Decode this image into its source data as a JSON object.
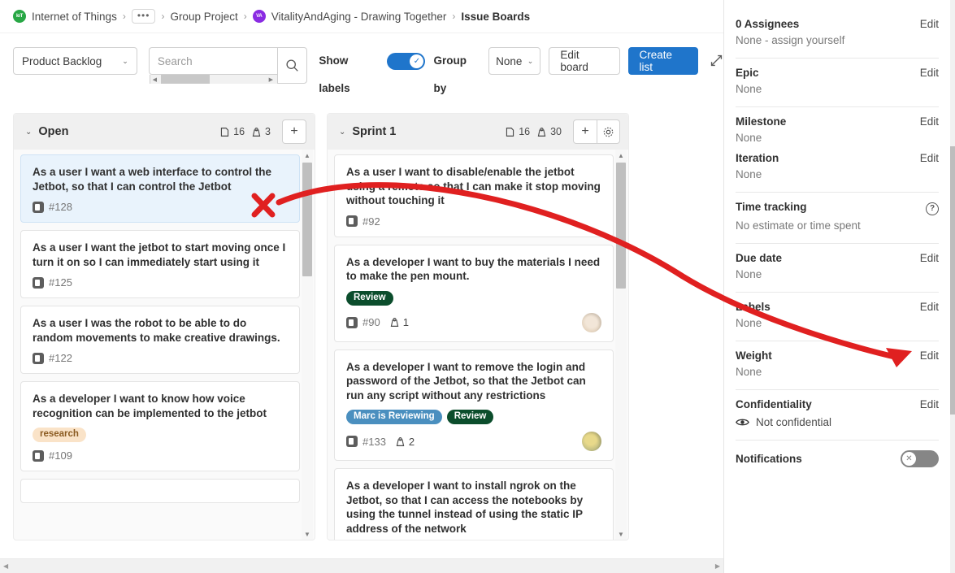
{
  "breadcrumb": {
    "items": [
      {
        "label": "Internet of Things",
        "icon": "group-avatar-green",
        "avatar_text": "IoT"
      },
      {
        "label": "•••",
        "icon": "ellipsis-button"
      },
      {
        "label": "Group Project",
        "icon": "none"
      },
      {
        "label": "VitalityAndAging - Drawing Together",
        "icon": "project-avatar-purple",
        "avatar_text": "VA"
      },
      {
        "label": "Issue Boards",
        "icon": "none",
        "current": true
      }
    ],
    "separator": "›"
  },
  "toolbar": {
    "board_select": {
      "value": "Product Backlog",
      "caret": "⌄"
    },
    "search": {
      "placeholder": "Search",
      "value": "",
      "icon": "search-icon"
    },
    "show_labels_label": "Show labels",
    "show_labels_on": true,
    "group_by_label": "Group by",
    "group_by_select": {
      "value": "None",
      "caret": "⌄"
    },
    "edit_board_label": "Edit board",
    "create_list_label": "Create list",
    "expand_icon": "expand-arrows-icon",
    "accent_color": "#1f75cb"
  },
  "board": {
    "columns": [
      {
        "title": "Open",
        "issue_count": "16",
        "weight": "3",
        "caret": "⌄",
        "actions": [
          "add-issue"
        ],
        "cards": [
          {
            "title": "As a user I want a web interface to control the Jetbot, so that I can control the Jetbot",
            "id": "#128",
            "labels": [],
            "weight": "",
            "avatar": "",
            "selected": true
          },
          {
            "title": "As a user I want the jetbot to start moving once I turn it on so I can immediately start using it",
            "id": "#125",
            "labels": [],
            "weight": "",
            "avatar": "",
            "selected": false
          },
          {
            "title": "As a user I was the robot to be able to do random movements to make creative drawings.",
            "id": "#122",
            "labels": [],
            "weight": "",
            "avatar": "",
            "selected": false
          },
          {
            "title": "As a developer I want to know how voice recognition can be implemented to the jetbot",
            "id": "#109",
            "labels": [
              {
                "text": "research",
                "bg": "#fae3c8",
                "fg": "#8a5a20"
              }
            ],
            "weight": "",
            "avatar": "",
            "selected": false
          }
        ]
      },
      {
        "title": "Sprint 1",
        "issue_count": "16",
        "weight": "30",
        "caret": "⌄",
        "actions": [
          "add-issue",
          "list-settings"
        ],
        "cards": [
          {
            "title": "As a user I want to disable/enable the jetbot using a remote so that I can make it stop moving without touching it",
            "id": "#92",
            "labels": [],
            "weight": "",
            "avatar": "",
            "selected": false
          },
          {
            "title": "As a developer I want to buy the materials I need to make the pen mount.",
            "id": "#90",
            "labels": [
              {
                "text": "Review",
                "bg": "#0b4d2c",
                "fg": "#ffffff"
              }
            ],
            "weight": "1",
            "avatar": "#e8d9c8",
            "selected": false
          },
          {
            "title": "As a developer I want to remove the login and password of the Jetbot, so that the Jetbot can run any script without any restrictions",
            "id": "#133",
            "labels": [
              {
                "text": "Marc is Reviewing",
                "bg": "#4a8fbf",
                "fg": "#ffffff"
              },
              {
                "text": "Review",
                "bg": "#0b4d2c",
                "fg": "#ffffff"
              }
            ],
            "weight": "2",
            "avatar": "#c8b87a",
            "selected": false
          },
          {
            "title": "As a developer I want to install ngrok on the Jetbot, so that I can access the notebooks by using the tunnel instead of using the static IP address of the network",
            "id": "",
            "labels": [],
            "weight": "",
            "avatar": "",
            "selected": false
          }
        ]
      }
    ]
  },
  "sidebar": {
    "rows": [
      {
        "label": "0 Assignees",
        "action": "Edit",
        "value": "None - assign yourself",
        "divider": true,
        "icon": "none"
      },
      {
        "label": "Epic",
        "action": "Edit",
        "value": "None",
        "divider": true,
        "icon": "none"
      },
      {
        "label": "Milestone",
        "action": "Edit",
        "value": "None",
        "divider": false,
        "icon": "none"
      },
      {
        "label": "Iteration",
        "action": "Edit",
        "value": "None",
        "divider": true,
        "icon": "none"
      },
      {
        "label": "Time tracking",
        "action": "",
        "value": "No estimate or time spent",
        "divider": true,
        "icon": "help-icon"
      },
      {
        "label": "Due date",
        "action": "Edit",
        "value": "None",
        "divider": true,
        "icon": "none"
      },
      {
        "label": "Labels",
        "action": "Edit",
        "value": "None",
        "divider": true,
        "icon": "none"
      },
      {
        "label": "Weight",
        "action": "Edit",
        "value": "None",
        "divider": true,
        "icon": "none"
      },
      {
        "label": "Confidentiality",
        "action": "Edit",
        "value": "Not confidential",
        "divider": true,
        "icon": "eye-icon"
      }
    ],
    "notifications_label": "Notifications",
    "notifications_on": false
  },
  "annotation": {
    "color": "#e02020",
    "x_mark": "X",
    "description": "red X over selected card with curved arrow pointing to Labels Edit"
  }
}
